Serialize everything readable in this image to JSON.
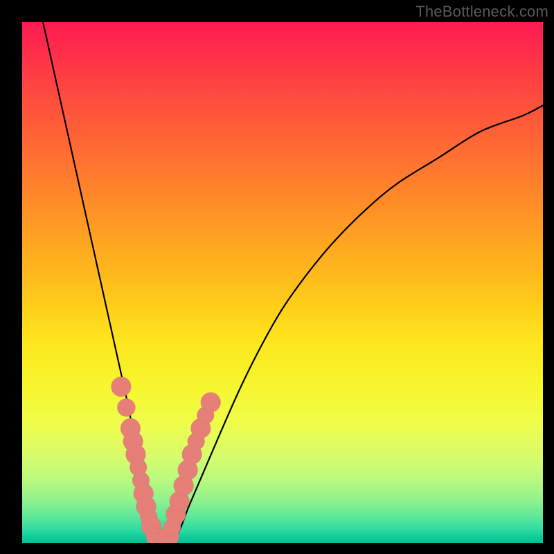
{
  "watermark": "TheBottleneck.com",
  "chart_data": {
    "type": "line",
    "title": "",
    "xlabel": "",
    "ylabel": "",
    "xlim": [
      0,
      100
    ],
    "ylim": [
      0,
      100
    ],
    "grid": false,
    "legend": false,
    "series": [
      {
        "name": "bottleneck-curve",
        "x": [
          4,
          6,
          8,
          10,
          12,
          14,
          16,
          18,
          20,
          21,
          22,
          23,
          24,
          25,
          26,
          27,
          28,
          30,
          32,
          35,
          38,
          42,
          46,
          50,
          55,
          60,
          66,
          72,
          80,
          88,
          96,
          100
        ],
        "values": [
          100,
          91,
          82,
          73,
          64,
          55,
          46,
          37,
          28,
          23,
          18,
          13,
          8,
          4,
          1,
          0,
          0,
          2,
          7,
          14,
          21,
          30,
          38,
          45,
          52,
          58,
          64,
          69,
          74,
          79,
          82,
          84
        ]
      }
    ],
    "markers": {
      "name": "beads",
      "comment": "salmon bead markers clustered near the V bottom",
      "points": [
        {
          "x": 19.0,
          "y": 30.0,
          "r": 1.4
        },
        {
          "x": 20.0,
          "y": 26.0,
          "r": 1.2
        },
        {
          "x": 20.8,
          "y": 22.0,
          "r": 1.4
        },
        {
          "x": 21.3,
          "y": 19.5,
          "r": 1.4
        },
        {
          "x": 21.8,
          "y": 17.0,
          "r": 1.4
        },
        {
          "x": 22.3,
          "y": 14.5,
          "r": 1.1
        },
        {
          "x": 22.8,
          "y": 12.0,
          "r": 1.1
        },
        {
          "x": 23.3,
          "y": 9.5,
          "r": 1.4
        },
        {
          "x": 23.8,
          "y": 7.0,
          "r": 1.4
        },
        {
          "x": 24.3,
          "y": 5.0,
          "r": 1.1
        },
        {
          "x": 24.8,
          "y": 3.2,
          "r": 1.4
        },
        {
          "x": 25.3,
          "y": 1.8,
          "r": 1.1
        },
        {
          "x": 25.8,
          "y": 0.8,
          "r": 1.4
        },
        {
          "x": 26.3,
          "y": 0.2,
          "r": 1.4
        },
        {
          "x": 26.8,
          "y": 0.0,
          "r": 1.4
        },
        {
          "x": 27.5,
          "y": 0.2,
          "r": 1.4
        },
        {
          "x": 28.2,
          "y": 1.2,
          "r": 1.4
        },
        {
          "x": 28.8,
          "y": 3.0,
          "r": 1.1
        },
        {
          "x": 29.5,
          "y": 5.5,
          "r": 1.4
        },
        {
          "x": 30.2,
          "y": 8.0,
          "r": 1.4
        },
        {
          "x": 31.0,
          "y": 11.0,
          "r": 1.4
        },
        {
          "x": 31.8,
          "y": 14.0,
          "r": 1.4
        },
        {
          "x": 32.6,
          "y": 17.0,
          "r": 1.4
        },
        {
          "x": 33.4,
          "y": 19.5,
          "r": 1.1
        },
        {
          "x": 34.3,
          "y": 22.0,
          "r": 1.4
        },
        {
          "x": 35.2,
          "y": 24.5,
          "r": 1.1
        },
        {
          "x": 36.2,
          "y": 27.0,
          "r": 1.4
        }
      ]
    },
    "background_gradient_stops": [
      {
        "pct": 0,
        "color": "#ff1a52"
      },
      {
        "pct": 24,
        "color": "#ff6a33"
      },
      {
        "pct": 54,
        "color": "#ffcc1a"
      },
      {
        "pct": 77,
        "color": "#effd4a"
      },
      {
        "pct": 92,
        "color": "#8ef18e"
      },
      {
        "pct": 100,
        "color": "#05c196"
      }
    ]
  }
}
